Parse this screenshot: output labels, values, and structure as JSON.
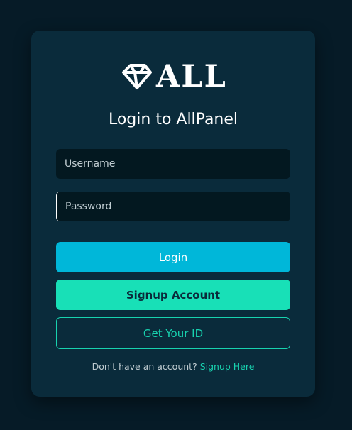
{
  "logo": {
    "text": "ALL",
    "icon": "diamond-icon"
  },
  "title": "Login to AllPanel",
  "form": {
    "username_placeholder": "Username",
    "password_placeholder": "Password"
  },
  "buttons": {
    "login": "Login",
    "signup": "Signup Account",
    "get_id": "Get Your ID"
  },
  "footer": {
    "question": "Don't have an account?",
    "link": "Signup Here"
  },
  "colors": {
    "background": "#061b27",
    "card": "#0a2b3b",
    "login_button": "#00b7d9",
    "signup_button": "#18e0b7",
    "accent": "#18d2af"
  }
}
